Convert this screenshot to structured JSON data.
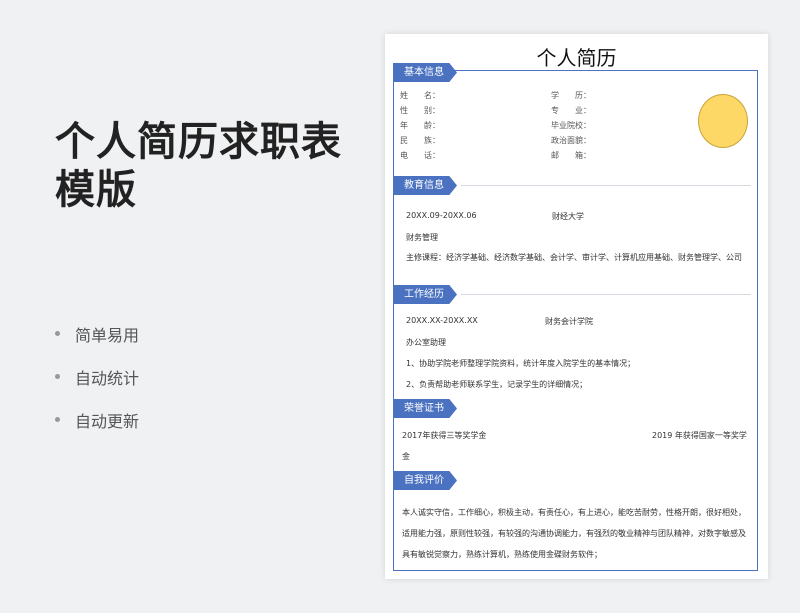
{
  "promo": {
    "title_line1": "个人简历求职表",
    "title_line2": "模版",
    "features": [
      "简单易用",
      "自动统计",
      "自动更新"
    ]
  },
  "resume": {
    "title": "个人简历",
    "basic": {
      "heading": "基本信息",
      "left_labels": [
        "姓　　名：",
        "性　　别：",
        "年　　龄：",
        "民　　族：",
        "电　　话："
      ],
      "right_labels": [
        "学　　历：",
        "专　　业：",
        "毕业院校：",
        "政治面貌：",
        "邮　　箱："
      ]
    },
    "education": {
      "heading": "教育信息",
      "period": "20XX.09-20XX.06",
      "school": "财经大学",
      "major": "财务管理",
      "courses": "主修课程：经济学基础、经济数学基础、会计学、审计学、计算机应用基础、财务管理学、公司"
    },
    "work": {
      "heading": "工作经历",
      "period": "20XX.XX-20XX.XX",
      "org": "财务会计学院",
      "role": "办公室助理",
      "duty1": "1、协助学院老师整理学院资料，统计年度入院学生的基本情况；",
      "duty2": "2、负责帮助老师联系学生，记录学生的详细情况；"
    },
    "honors": {
      "heading": "荣誉证书",
      "item1": "2017年获得三等奖学金",
      "item2": "2019 年获得国家一等奖学",
      "item2_cont": "金"
    },
    "self_eval": {
      "heading": "自我评价",
      "line1": "本人诚实守信，工作细心，积极主动，有责任心，有上进心，能吃苦耐劳，性格开朗，很好相处，",
      "line2": "适用能力强，原则性较强，有较强的沟通协调能力，有强烈的敬业精神与团队精神，对数字敏感及",
      "line3": "具有敏锐觉察力，熟练计算机，熟练使用金碟财务软件；"
    }
  },
  "colors": {
    "accent": "#4a72c0",
    "photo": "#fdd866"
  }
}
